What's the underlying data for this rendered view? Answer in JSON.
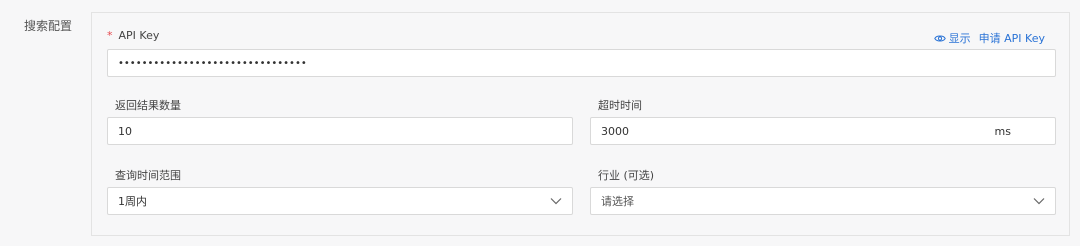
{
  "section_label": "搜索配置",
  "api_key": {
    "label": "API Key",
    "required_mark": "*",
    "masked_value": "••••••••••••••••••••••••••••••••",
    "show_link": "显示",
    "apply_link": "申请 API Key"
  },
  "result_count": {
    "label": "返回结果数量",
    "value": "10"
  },
  "timeout": {
    "label": "超时时间",
    "value": "3000",
    "unit": "ms"
  },
  "time_range": {
    "label": "查询时间范围",
    "selected": "1周内"
  },
  "industry": {
    "label": "行业 (可选)",
    "placeholder": "请选择"
  },
  "colors": {
    "accent": "#2a73d6",
    "required": "#e5484d",
    "border": "#d9d9d9"
  },
  "icons": {
    "show": "eye-icon",
    "select": "chevron-down-icon"
  }
}
